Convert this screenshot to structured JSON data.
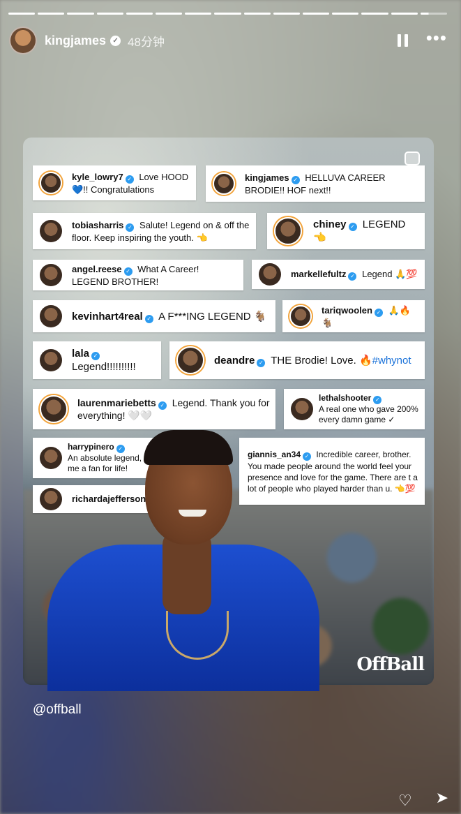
{
  "story": {
    "username": "kingjames",
    "time": "48分钟",
    "segments": 15,
    "source_handle": "@offball"
  },
  "post": {
    "watermark": "OffBall"
  },
  "comments": [
    {
      "user": "kyle_lowry7",
      "text": " Love HOOD💙!! Congratulations"
    },
    {
      "user": "kingjames",
      "text": " HELLUVA CAREER BRODIE!! HOF next!!"
    },
    {
      "user": "tobiasharris",
      "text": " Salute! Legend on & off the floor. Keep inspiring the youth. 👈"
    },
    {
      "user": "chiney",
      "text": " LEGEND 👈"
    },
    {
      "user": "angel.reese",
      "text": " What A Career! LEGEND BROTHER!"
    },
    {
      "user": "markellefultz",
      "text": " Legend 🙏💯"
    },
    {
      "user": "kevinhart4real",
      "text": " A F***ING LEGEND 🐐"
    },
    {
      "user": "tariqwoolen",
      "text": " 🙏🔥🐐"
    },
    {
      "user": "lala",
      "text": " Legend!!!!!!!!!!"
    },
    {
      "user": "deandre",
      "text": " THE Brodie! Love. 🔥",
      "tag": "#whynot"
    },
    {
      "user": "laurenmariebetts",
      "text": " Legend. Thank you for everything! 🤍🤍"
    },
    {
      "user": "lethalshooter",
      "text": "A real one who gave 200% every damn game ✓"
    },
    {
      "user": "harrypinero",
      "text": "An absolute legend, that made me a fan for life!"
    },
    {
      "user": "giannis_an34",
      "text": " Incredible career, brother. You made people around the world feel your presence and love for the game. There are t a lot of people who played harder than u. 👈💯"
    },
    {
      "user": "richardajefferson",
      "text": ""
    }
  ]
}
